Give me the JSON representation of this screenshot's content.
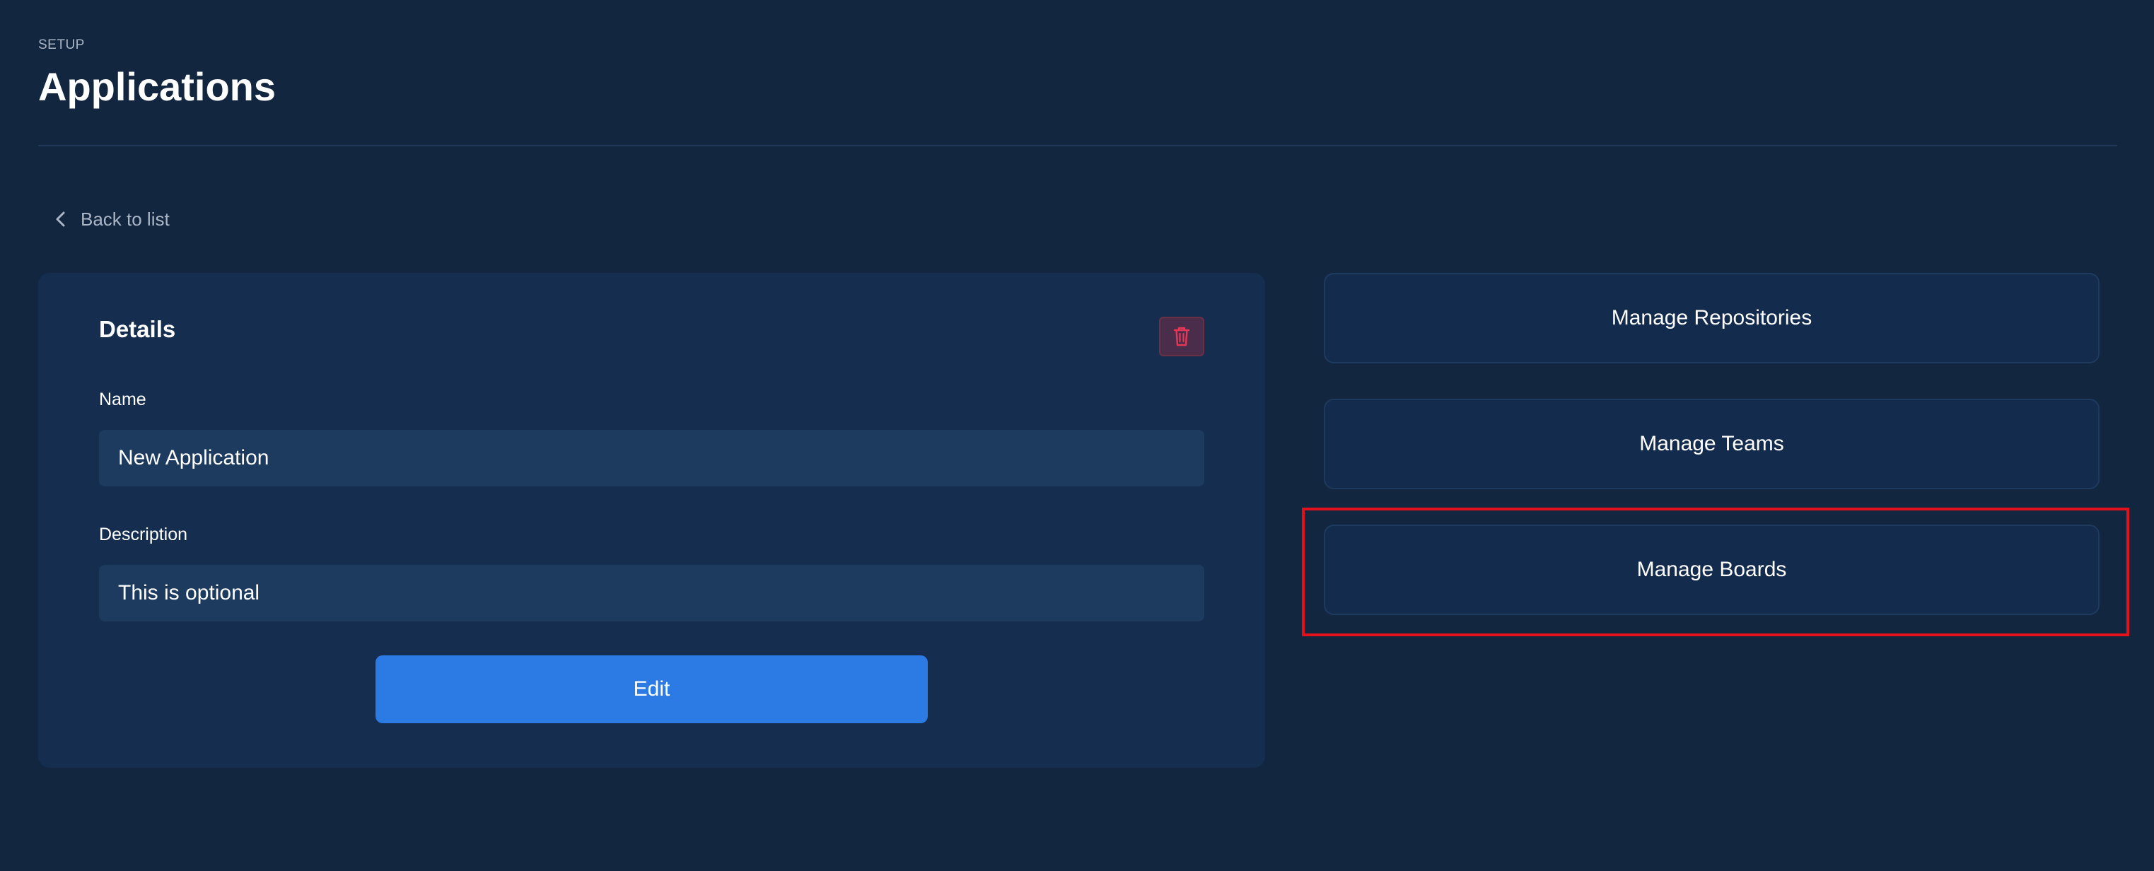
{
  "header": {
    "eyebrow": "SETUP",
    "title": "Applications"
  },
  "nav": {
    "back_label": "Back to list",
    "back_icon": "chevron-left-icon"
  },
  "details": {
    "title": "Details",
    "delete_icon": "trash-icon",
    "name_label": "Name",
    "name_value": "New Application",
    "description_label": "Description",
    "description_placeholder": "This is optional",
    "description_value": "",
    "edit_label": "Edit"
  },
  "actions": {
    "repositories_label": "Manage Repositories",
    "teams_label": "Manage Teams",
    "boards_label": "Manage Boards"
  },
  "colors": {
    "background": "#12263f",
    "card": "#152e50",
    "input": "#1d3a5f",
    "primary": "#2c7be5",
    "danger": "#e63757",
    "highlight": "#e3111a"
  }
}
